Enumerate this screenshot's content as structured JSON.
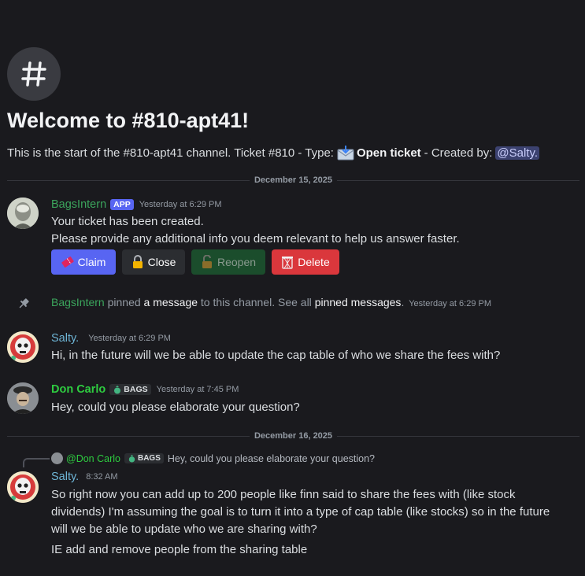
{
  "channel": {
    "welcome_title": "Welcome to #810-apt41!",
    "intro_prefix": "This is the start of the #810-apt41 channel. Ticket #810 - Type:",
    "intro_type": "Open ticket",
    "intro_created_by": "- Created by:",
    "intro_creator": "@Salty."
  },
  "dividers": [
    "December 15, 2025",
    "December 16, 2025"
  ],
  "messages": [
    {
      "author": "BagsIntern",
      "tag": "APP",
      "timestamp": "Yesterday at 6:29 PM",
      "lines": [
        "Your ticket has been created.",
        "Please provide any additional info you deem relevant to help us answer faster."
      ],
      "buttons": [
        "Claim",
        "Close",
        "Reopen",
        "Delete"
      ]
    },
    {
      "system": true,
      "actor": "BagsIntern",
      "pinned": "pinned",
      "a_message": "a message",
      "to_channel": "to this channel. See all",
      "pinned_messages": "pinned messages",
      "period": ".",
      "timestamp": "Yesterday at 6:29 PM"
    },
    {
      "author": "Salty.",
      "timestamp": "Yesterday at 6:29 PM",
      "lines": [
        "Hi, in the future will we be able to update the cap table of who we share the fees with?"
      ]
    },
    {
      "author": "Don Carlo",
      "tag": "BAGS",
      "timestamp": "Yesterday at 7:45 PM",
      "lines": [
        "Hey, could you please elaborate your question?"
      ]
    },
    {
      "reply_to": {
        "author": "@Don Carlo",
        "tag": "BAGS",
        "text": "Hey, could you please elaborate your question?"
      },
      "author": "Salty.",
      "timestamp": "8:32 AM",
      "lines": [
        "So right now you can add up to 200 people like finn said to share the fees with (like stock",
        "dividends) I'm assuming the goal is to turn it into a type of cap table (like stocks) so in the future",
        "will we be able to update who we are sharing with?",
        "IE add and remove people from the sharing table"
      ]
    }
  ],
  "colors": {
    "background": "#1a1a1e",
    "bagsintern": "#3ba55c",
    "salty": "#6eb5d6",
    "don_carlo": "#2ecc40",
    "mention_bg": "#3c4270",
    "app_tag": "#5865f2"
  },
  "icons": {
    "channel": "hash-icon",
    "type": "envelope-icon",
    "pin": "pin-icon",
    "claim": "ticket-icon",
    "close": "lock-icon",
    "reopen": "unlock-icon",
    "delete": "trash-icon"
  }
}
